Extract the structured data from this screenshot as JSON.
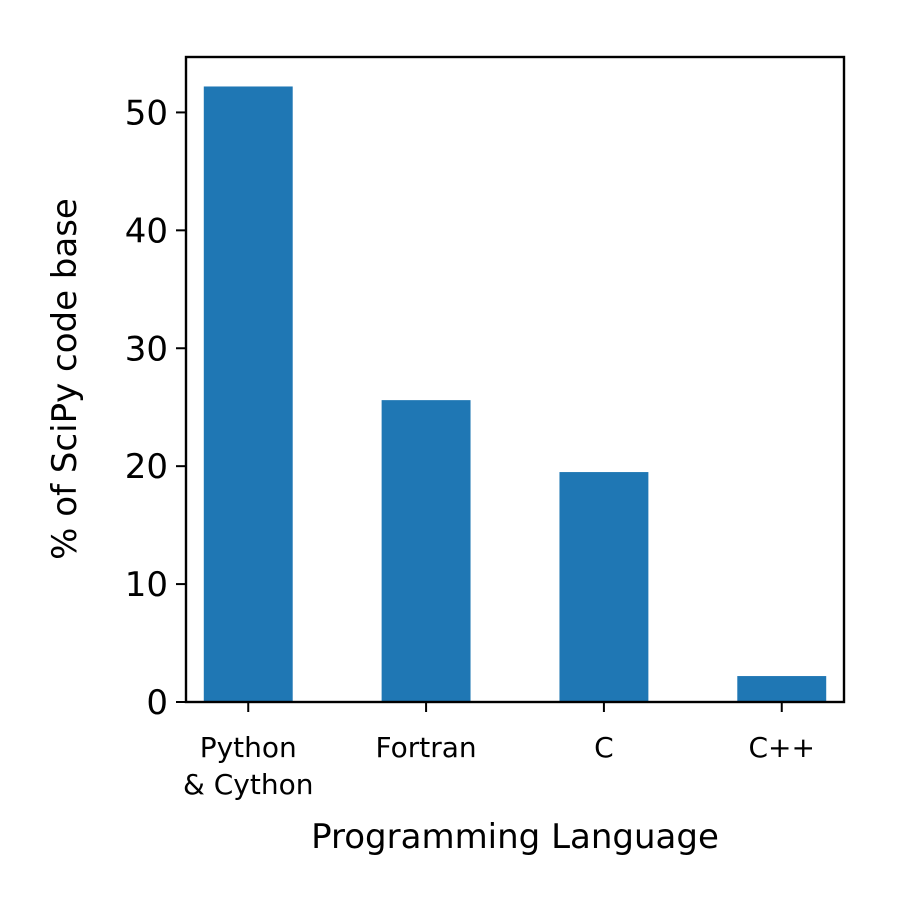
{
  "chart_data": {
    "type": "bar",
    "title": "",
    "xlabel": "Programming Language",
    "ylabel": "% of SciPy code base",
    "categories": [
      [
        "Python",
        "& Cython"
      ],
      [
        "Fortran"
      ],
      [
        "C"
      ],
      [
        "C++"
      ]
    ],
    "values": [
      52.2,
      25.6,
      19.5,
      2.2
    ],
    "ylim": [
      0,
      54.7
    ],
    "yticks": [
      0,
      10,
      20,
      30,
      40,
      50
    ],
    "bar_color": "#1f77b4",
    "grid": false,
    "legend": "none"
  }
}
